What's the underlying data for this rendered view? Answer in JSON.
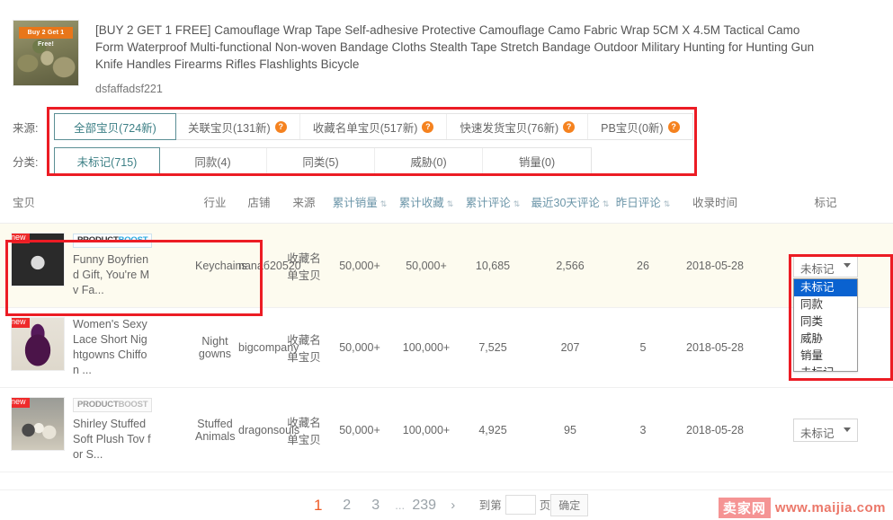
{
  "product": {
    "title": "[BUY 2 GET 1 FREE] Camouflage Wrap Tape Self-adhesive Protective Camouflage Camo Fabric Wrap 5CM X 4.5M Tactical Camo Form Waterproof Multi-functional Non-woven Bandage Cloths Stealth Tape Stretch Bandage Outdoor Military Hunting for Hunting Gun Knife Handles Firearms Rifles Flashlights Bicycle",
    "seller": "dsfaffadsf221",
    "thumb_promo": "Buy 2 Get 1 Free!"
  },
  "filters": {
    "source_label": "来源:",
    "category_label": "分类:",
    "source_tabs": [
      {
        "label": "全部宝贝(724新)",
        "active": true,
        "help": false
      },
      {
        "label": "关联宝贝(131新)",
        "active": false,
        "help": true
      },
      {
        "label": "收藏名单宝贝(517新)",
        "active": false,
        "help": true
      },
      {
        "label": "快速发货宝贝(76新)",
        "active": false,
        "help": true
      },
      {
        "label": "PB宝贝(0新)",
        "active": false,
        "help": true
      }
    ],
    "category_tabs": [
      {
        "label": "未标记(715)",
        "active": true
      },
      {
        "label": "同款(4)",
        "active": false
      },
      {
        "label": "同类(5)",
        "active": false
      },
      {
        "label": "威胁(0)",
        "active": false
      },
      {
        "label": "销量(0)",
        "active": false
      }
    ],
    "help_glyph": "?"
  },
  "table": {
    "headers": [
      {
        "label": "宝贝",
        "sortable": false
      },
      {
        "label": "行业",
        "sortable": false
      },
      {
        "label": "店铺",
        "sortable": false
      },
      {
        "label": "来源",
        "sortable": false
      },
      {
        "label": "累计销量",
        "sortable": true
      },
      {
        "label": "累计收藏",
        "sortable": true
      },
      {
        "label": "累计评论",
        "sortable": true
      },
      {
        "label": "最近30天评论",
        "sortable": true
      },
      {
        "label": "昨日评论",
        "sortable": true
      },
      {
        "label": "收录时间",
        "sortable": false
      },
      {
        "label": "标记",
        "sortable": false
      }
    ],
    "sort_glyph": "⇅",
    "rows": [
      {
        "new_badge": "new",
        "boost_badge_1": "PRODUCT",
        "boost_badge_2": "BOOST",
        "boost_dim": false,
        "title": "Funny Boyfriend Gift, You're Mv Fa...",
        "industry": "Keychains",
        "shop": "nanaб20520",
        "source": "收藏名单宝贝",
        "sales": "50,000+",
        "favorites": "50,000+",
        "comments": "10,685",
        "comments_30d": "2,566",
        "comments_yesterday": "26",
        "collected_at": "2018-05-28",
        "mark_value": "未标记",
        "highlight": true,
        "dropdown_open": true
      },
      {
        "new_badge": "new",
        "boost_badge_1": "",
        "boost_badge_2": "",
        "boost_dim": false,
        "title": "Women's Sexy Lace Short Nightgowns Chiffon ...",
        "industry": "Night gowns",
        "shop": "bigcompany",
        "source": "收藏名单宝贝",
        "sales": "50,000+",
        "favorites": "100,000+",
        "comments": "7,525",
        "comments_30d": "207",
        "comments_yesterday": "5",
        "collected_at": "2018-05-28",
        "mark_value": "未标记",
        "highlight": false,
        "dropdown_open": false
      },
      {
        "new_badge": "new",
        "boost_badge_1": "PRODUCT",
        "boost_badge_2": "BOOST",
        "boost_dim": true,
        "title": "Shirley Stuffed Soft Plush Tov for S...",
        "industry": "Stuffed Animals",
        "shop": "dragonsouls",
        "source": "收藏名单宝贝",
        "sales": "50,000+",
        "favorites": "100,000+",
        "comments": "4,925",
        "comments_30d": "95",
        "comments_yesterday": "3",
        "collected_at": "2018-05-28",
        "mark_value": "未标记",
        "highlight": false,
        "dropdown_open": false
      }
    ],
    "mark_options": [
      "未标记",
      "同款",
      "同类",
      "威胁",
      "销量"
    ],
    "mark_selected_index": 0
  },
  "pagination": {
    "pages": [
      "1",
      "2",
      "3"
    ],
    "current": "1",
    "dots": "...",
    "last": "239",
    "next_glyph": "›",
    "goto_label": "到第",
    "goto_value": "",
    "goto_suffix": "页",
    "confirm_label": "确定"
  },
  "watermark": {
    "cn": "卖家网",
    "url": "www.maijia.com"
  }
}
